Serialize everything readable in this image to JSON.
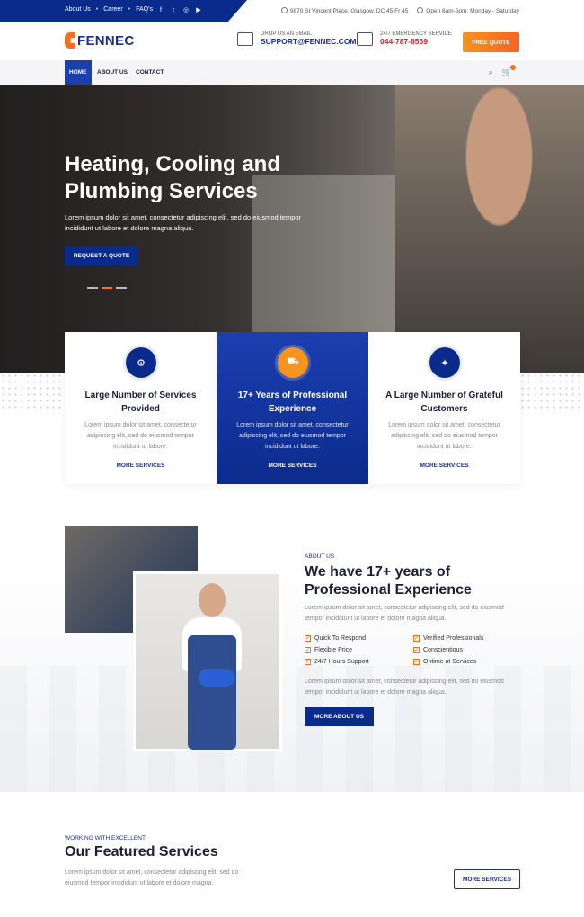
{
  "topbar": {
    "links": [
      "About Us",
      "Career",
      "FAQ's"
    ],
    "social": [
      "f",
      "t",
      "◎",
      "▶"
    ],
    "address": "9870 St Vincent Place, Glasgow, DC 45 Fr 45",
    "hours": "Open 8am-5pm: Monday - Saturday"
  },
  "header": {
    "logo": "FENNEC",
    "email_label": "DROP US AN EMAIL",
    "email": "SUPPORT@FENNEC.COM",
    "phone_label": "24/7 EMERGENCY SERVICE",
    "phone": "044-787-8569",
    "quote_button": "FREE QUOTE"
  },
  "nav": {
    "items": [
      "HOME",
      "ABOUT US",
      "CONTACT"
    ]
  },
  "hero": {
    "title": "Heating, Cooling and Plumbing Services",
    "text": "Lorem ipsum dolor sit amet, consectetur adipiscing elit, sed do eiusmod tempor incididunt ut labore et dolore magna aliqua.",
    "button": "REQUEST A QUOTE"
  },
  "features": [
    {
      "title": "Large Number of Services Provided",
      "text": "Lorem ipsum dolor sit amet, consectetur adipiscing elit, sed do eiusmod tempor incididunt ut labore.",
      "link": "MORE SERVICES"
    },
    {
      "title": "17+ Years of Professional Experience",
      "text": "Lorem ipsum dolor sit amet, consectetur adipiscing elit, sed do eiusmod tempor incididunt ut labore.",
      "link": "MORE SERVICES"
    },
    {
      "title": "A Large Number of Grateful Customers",
      "text": "Lorem ipsum dolor sit amet, consectetur adipiscing elit, sed do eiusmod tempor incididunt ut labore.",
      "link": "MORE SERVICES"
    }
  ],
  "about": {
    "tag": "ABOUT US",
    "title": "We have 17+ years of Professional Experience",
    "text1": "Lorem ipsum dolor sit amet, consectetur adipiscing elit, sed do eiusmod tempor incididunt ut labore et dolore magna aliqua.",
    "checks": [
      "Quick To Respond",
      "Verified Professionals",
      "Flexible Price",
      "Conscientious",
      "24/7 Hours Support",
      "Ontime at Services"
    ],
    "text2": "Lorem ipsum dolor sit amet, consectetur adipiscing elit, sed do eiusmod tempor incididunt ut labore et dolore magna aliqua.",
    "button": "MORE ABOUT US"
  },
  "services": {
    "tag": "WORKING WITH EXCELLENT",
    "title": "Our Featured Services",
    "text": "Lorem ipsum dolor sit amet, consectetur adipiscing elit, sed do eiusmod tempor incididunt ut labore et dolore magna.",
    "button": "MORE SERVICES"
  },
  "colors": {
    "primary": "#0b2b8c",
    "accent": "#f37021"
  }
}
